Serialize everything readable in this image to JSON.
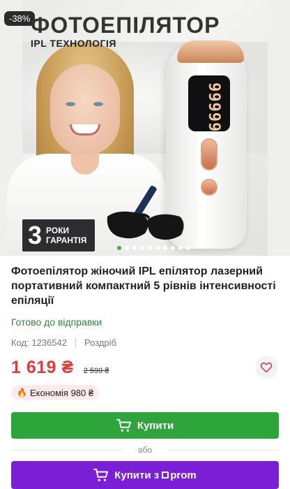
{
  "hero": {
    "discount_badge": "-38%",
    "headline": "ФОТОЕПІЛЯТОР",
    "subhead": "IPL ТЕХНОЛОГІЯ",
    "warranty_number": "3",
    "warranty_line1": "РОКИ",
    "warranty_line2": "ГАРАНТІЯ",
    "device_display": "99999",
    "carousel": {
      "total": 10,
      "active_index": 0
    }
  },
  "product": {
    "title": "Фотоепілятор жіночий IPL епілятор лазерний портативний компактний 5 рівнів інтенсивності епіляції",
    "stock_status": "Готово до відправки",
    "code_label": "Код:",
    "code_value": "1236542",
    "seller_type": "Роздріб",
    "price": "1 619",
    "currency": "₴",
    "old_price": "2 599 ₴",
    "economy": "Економія 980 ₴"
  },
  "actions": {
    "buy_label": "Купити",
    "or_label": "або",
    "prom_buy_label": "Купити з",
    "prom_brand": "prom"
  },
  "colors": {
    "price": "#e33a3a",
    "buy_button": "#2ea53b",
    "prom_button": "#7b1fd6",
    "stock": "#2f8a3a"
  },
  "icons": {
    "favorite": "heart-icon",
    "cart": "cart-icon",
    "fire": "fire-icon"
  }
}
